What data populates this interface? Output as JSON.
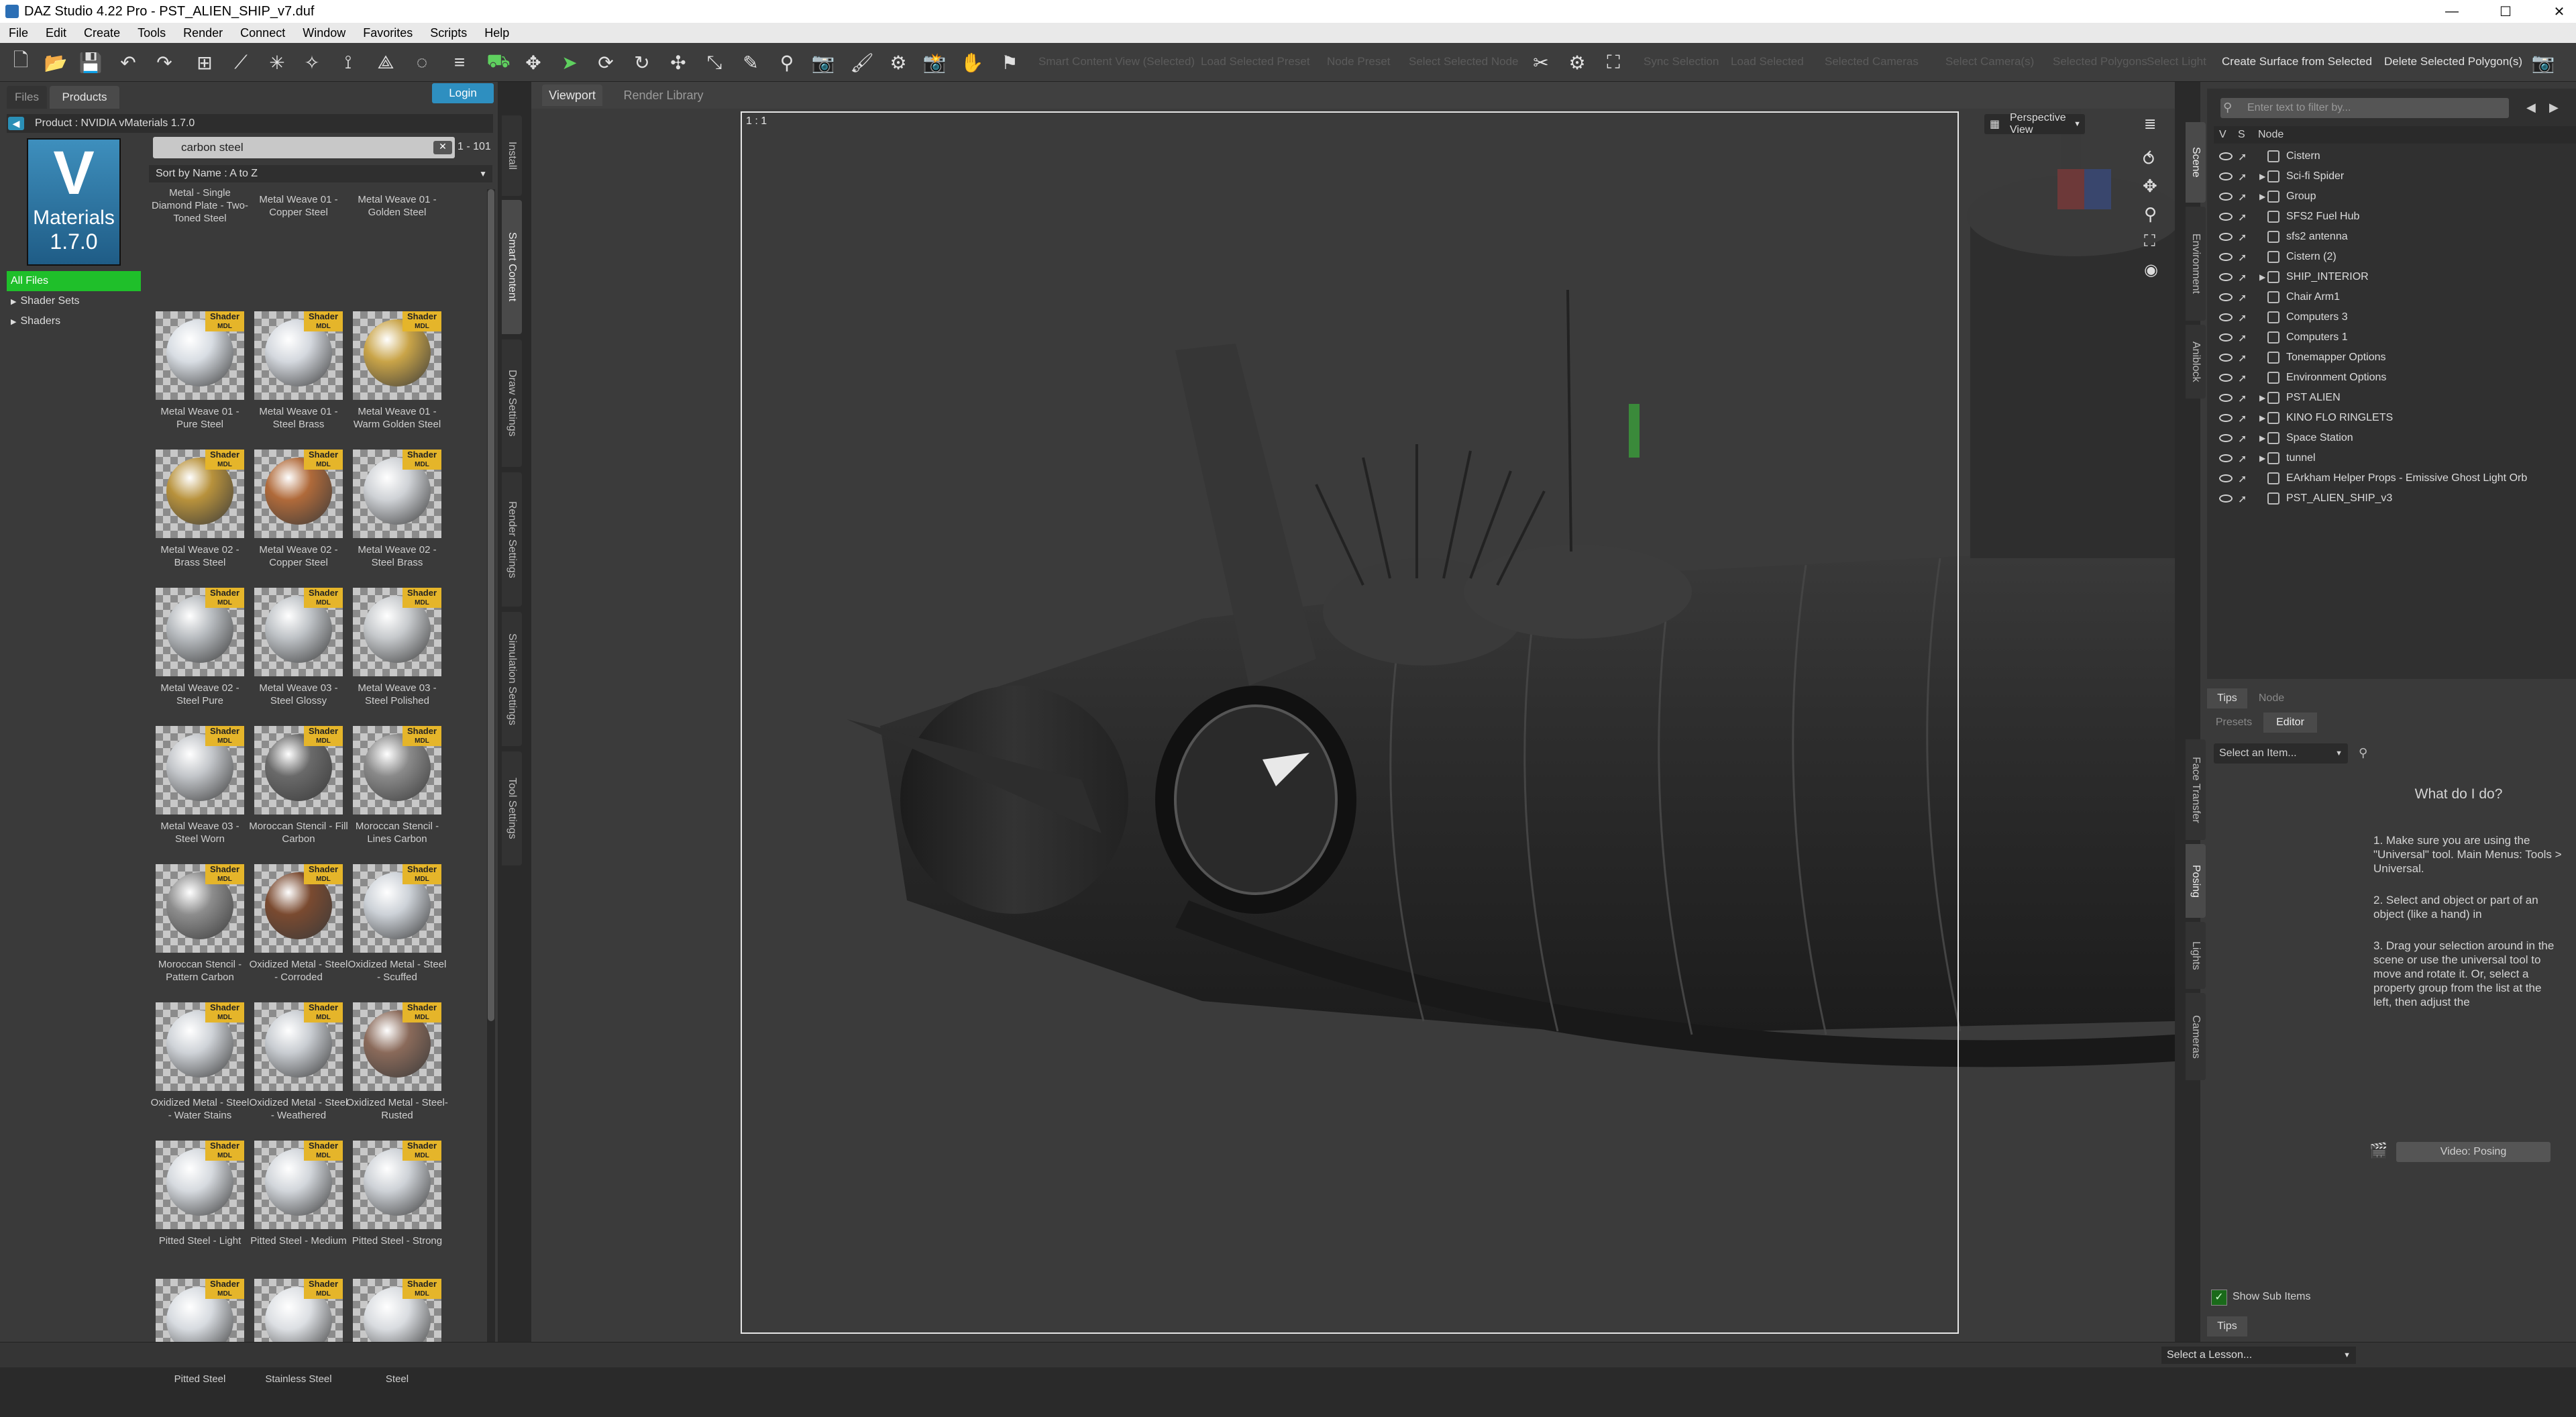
{
  "window": {
    "title": "DAZ Studio 4.22 Pro - PST_ALIEN_SHIP_v7.duf",
    "minimize": "—",
    "maximize": "☐",
    "close": "✕"
  },
  "menu": [
    "File",
    "Edit",
    "Create",
    "Tools",
    "Render",
    "Connect",
    "Window",
    "Favorites",
    "Scripts",
    "Help"
  ],
  "toolbar": {
    "create_surface": "Create Surface from Selected",
    "delete_polygons": "Delete Selected Polygon(s)",
    "dimmed": [
      "Smart Content View (Selected)",
      "Load Selected Preset",
      "Node Preset",
      "Select Selected Node",
      "Sync Selection",
      "Load Selected",
      "Selected Cameras",
      "Select Camera(s)",
      "Selected Polygons",
      "Select Light"
    ]
  },
  "left_panel": {
    "tabs": [
      "Files",
      "Products"
    ],
    "login": "Login",
    "product_line": "Product : NVIDIA vMaterials 1.7.0",
    "product_thumb": {
      "letter": "V",
      "line1": "Materials",
      "line2": "1.7.0"
    },
    "tree": [
      "All Files",
      "Shader Sets",
      "Shaders"
    ],
    "search_value": "carbon steel",
    "result_count": "1 - 101",
    "sort": "Sort by Name : A to Z",
    "badge": {
      "line1": "Shader",
      "line2": "MDL"
    },
    "top_labels": [
      "Metal - Single Diamond Plate - Two-Toned Steel",
      "Metal Weave 01 - Copper Steel",
      "Metal Weave 01 - Golden Steel"
    ],
    "items": [
      {
        "label": "Metal Weave 01 - Pure Steel",
        "color": "#d8dde3"
      },
      {
        "label": "Metal Weave 01 - Steel Brass",
        "color": "#d4d8de"
      },
      {
        "label": "Metal Weave 01 - Warm Golden Steel",
        "color": "#c9a448"
      },
      {
        "label": "Metal Weave 02 - Brass Steel",
        "color": "#b8923c"
      },
      {
        "label": "Metal Weave 02 - Copper Steel",
        "color": "#b06a3a"
      },
      {
        "label": "Metal Weave 02 - Steel Brass",
        "color": "#cfd2d6"
      },
      {
        "label": "Metal Weave 02 - Steel Pure",
        "color": "#b8bcc0"
      },
      {
        "label": "Metal Weave 03 - Steel Glossy",
        "color": "#bfc3c7"
      },
      {
        "label": "Metal Weave 03 - Steel Polished",
        "color": "#c7cacd"
      },
      {
        "label": "Metal Weave 03 - Steel Worn",
        "color": "#c3c6ca"
      },
      {
        "label": "Moroccan Stencil - Fill Carbon",
        "color": "#6a6a6a"
      },
      {
        "label": "Moroccan Stencil - Lines Carbon",
        "color": "#8a8a8a"
      },
      {
        "label": "Moroccan Stencil - Pattern Carbon",
        "color": "#8d8d8d"
      },
      {
        "label": "Oxidized Metal - Steel - Corroded",
        "color": "#7a4a30"
      },
      {
        "label": "Oxidized Metal - Steel - Scuffed",
        "color": "#cdd2d8"
      },
      {
        "label": "Oxidized Metal - Steel - Water Stains",
        "color": "#cfd3d8"
      },
      {
        "label": "Oxidized Metal - Steel - Weathered",
        "color": "#c9cdd2"
      },
      {
        "label": "Oxidized Metal - Steel- Rusted",
        "color": "#8a6a5a"
      },
      {
        "label": "Pitted Steel - Light",
        "color": "#d6dadf"
      },
      {
        "label": "Pitted Steel - Medium",
        "color": "#d2d6db"
      },
      {
        "label": "Pitted Steel - Strong",
        "color": "#ced2d7"
      },
      {
        "label": "Pitted Steel",
        "color": "#d7dbe0"
      },
      {
        "label": "Stainless Steel",
        "color": "#dcdfe3"
      },
      {
        "label": "Steel",
        "color": "#d9dce0"
      }
    ],
    "side_tabs": [
      "Install",
      "Smart Content",
      "Draw Settings",
      "Render Settings",
      "Simulation Settings",
      "Tool Settings"
    ]
  },
  "viewport": {
    "tabs": [
      "Viewport",
      "Render Library"
    ],
    "ratio": "1 : 1",
    "view": "Perspective View"
  },
  "right_panel": {
    "side_tabs": [
      "Scene",
      "Environment",
      "Aniblock",
      "Face Transfer",
      "Posing",
      "Lights",
      "Cameras"
    ],
    "filter_placeholder": "Enter text to filter by...",
    "headers": {
      "v": "V",
      "s": "S",
      "node": "Node"
    },
    "nodes": [
      "Cistern",
      "Sci-fi Spider",
      "Group",
      "SFS2 Fuel Hub",
      "sfs2 antenna",
      "Cistern (2)",
      "SHIP_INTERIOR",
      "Chair Arm1",
      "Computers 3",
      "Computers 1",
      "Tonemapper Options",
      "Environment Options",
      "PST ALIEN",
      "KINO FLO RINGLETS",
      "Space Station",
      "tunnel",
      "EArkham Helper Props - Emissive Ghost Light Orb",
      "PST_ALIEN_SHIP_v3"
    ],
    "bottom_tabs": [
      "Tips",
      "Node"
    ],
    "editor_tabs": [
      "Presets",
      "Editor"
    ],
    "select_item": "Select an Item...",
    "help_title": "What do I do?",
    "help_steps": [
      "1. Make sure you are using the \"Universal\" tool. Main Menus: Tools > Universal.",
      "2. Select and object or part of an object (like a hand) in",
      "3. Drag your selection around in the scene or use the universal tool to move and rotate it. Or, select a property group from the list at the left, then adjust the"
    ],
    "video_button": "Video: Posing",
    "show_sub_items": "Show Sub Items",
    "tips_tab": "Tips"
  },
  "status": {
    "lesson": "Select a Lesson..."
  }
}
